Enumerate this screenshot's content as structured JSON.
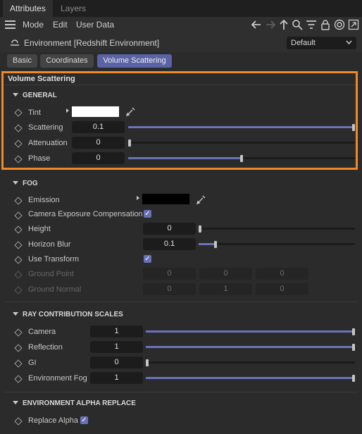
{
  "tabs": [
    {
      "label": "Attributes",
      "active": true
    },
    {
      "label": "Layers",
      "active": false
    }
  ],
  "menu": {
    "items": [
      "Mode",
      "Edit",
      "User Data"
    ]
  },
  "object": {
    "title": "Environment [Redshift Environment]",
    "preset": "Default"
  },
  "page_tabs": [
    {
      "label": "Basic",
      "active": false
    },
    {
      "label": "Coordinates",
      "active": false
    },
    {
      "label": "Volume Scattering",
      "active": true
    }
  ],
  "group_title": "Volume Scattering",
  "general": {
    "title": "GENERAL",
    "tint": {
      "label": "Tint",
      "color": "#ffffff"
    },
    "scattering": {
      "label": "Scattering",
      "value": "0.1",
      "fraction": 1.0
    },
    "attenuation": {
      "label": "Attenuation",
      "value": "0",
      "fraction": 0.0
    },
    "phase": {
      "label": "Phase",
      "value": "0",
      "fraction": 0.5
    }
  },
  "fog": {
    "title": "FOG",
    "emission": {
      "label": "Emission",
      "color": "#000000"
    },
    "camera_exposure": {
      "label": "Camera Exposure Compensation",
      "checked": true
    },
    "height": {
      "label": "Height",
      "value": "0",
      "fraction": 0.0
    },
    "horizon_blur": {
      "label": "Horizon Blur",
      "value": "0.1",
      "fraction": 0.1
    },
    "use_transform": {
      "label": "Use Transform",
      "checked": true
    },
    "ground_point": {
      "label": "Ground Point",
      "values": [
        "0",
        "0",
        "0"
      ]
    },
    "ground_normal": {
      "label": "Ground Normal",
      "values": [
        "0",
        "1",
        "0"
      ]
    }
  },
  "ray": {
    "title": "RAY CONTRIBUTION SCALES",
    "camera": {
      "label": "Camera",
      "value": "1",
      "fraction": 1.0
    },
    "reflection": {
      "label": "Reflection",
      "value": "1",
      "fraction": 1.0
    },
    "gi": {
      "label": "GI",
      "value": "0",
      "fraction": 0.0
    },
    "environment_fog": {
      "label": "Environment Fog",
      "value": "1",
      "fraction": 1.0
    }
  },
  "alpha": {
    "title": "ENVIRONMENT ALPHA REPLACE",
    "replace_alpha": {
      "label": "Replace Alpha",
      "checked": true
    }
  },
  "icons": [
    "hamburger-icon",
    "arrow-left-icon",
    "arrow-right-icon",
    "arrow-up-icon",
    "search-icon",
    "filter-icon",
    "lock-icon",
    "target-icon",
    "external-window-icon",
    "eyedropper-icon",
    "chevron-down-icon"
  ],
  "colors": {
    "accent": "#6870b6",
    "highlight": "#f08a26"
  }
}
